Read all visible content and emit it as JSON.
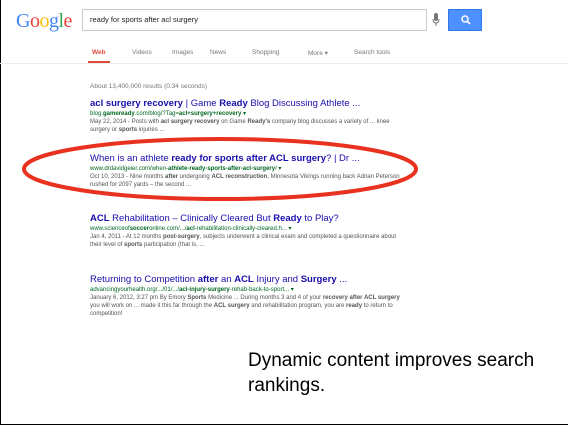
{
  "logo": {
    "letters": [
      "G",
      "o",
      "o",
      "g",
      "l",
      "e"
    ],
    "colors": [
      "#4285f4",
      "#ea4335",
      "#fbbc05",
      "#4285f4",
      "#34a853",
      "#ea4335"
    ]
  },
  "search": {
    "query": "ready for sports after acl surgery"
  },
  "tabs": [
    {
      "label": "Web",
      "active": true
    },
    {
      "label": "Videos",
      "active": false
    },
    {
      "label": "Images",
      "active": false
    },
    {
      "label": "News",
      "active": false
    },
    {
      "label": "Shopping",
      "active": false
    },
    {
      "label": "More ▾",
      "active": false
    },
    {
      "label": "Search tools",
      "active": false
    }
  ],
  "stats": "About 13,400,000 results (0.34 seconds)",
  "results": [
    {
      "title_parts": [
        [
          "acl surgery recovery",
          1
        ],
        [
          " | Game ",
          0
        ],
        [
          "Ready",
          1
        ],
        [
          " Blog Discussing Athlete ...",
          0
        ]
      ],
      "url_parts": [
        [
          "blog.",
          0
        ],
        [
          "gameready",
          1
        ],
        [
          ".com/blog/?Tag=",
          0
        ],
        [
          "acl+surgery+recovery",
          1
        ],
        [
          " ▾",
          0
        ]
      ],
      "snippet_parts": [
        [
          "May 22, 2014 - Posts with ",
          0
        ],
        [
          "acl surgery recovery",
          1
        ],
        [
          " on Game ",
          0
        ],
        [
          "Ready's",
          1
        ],
        [
          " company blog discusses a variety of ... knee surgery or ",
          0
        ],
        [
          "sports",
          1
        ],
        [
          " injuries ...",
          0
        ]
      ]
    },
    {
      "title_parts": [
        [
          "When is an athlete ",
          0
        ],
        [
          "ready for sports after ACL surgery",
          1
        ],
        [
          "? | Dr ...",
          0
        ]
      ],
      "url_parts": [
        [
          "www.drdavidgeier.com/when-",
          0
        ],
        [
          "athlete-ready-sports-after-acl-surgery",
          1
        ],
        [
          "/ ▾",
          0
        ]
      ],
      "snippet_parts": [
        [
          "Oct 10, 2013 - Nine months ",
          0
        ],
        [
          "after",
          1
        ],
        [
          " undergoing ",
          0
        ],
        [
          "ACL reconstruction",
          1
        ],
        [
          ", Minnesota Vikings running back Adrian Peterson rushed for 2097 yards – the second ...",
          0
        ]
      ]
    },
    {
      "title_parts": [
        [
          "ACL",
          1
        ],
        [
          " Rehabilitation – Clinically Cleared But ",
          0
        ],
        [
          "Ready",
          1
        ],
        [
          " to Play?",
          0
        ]
      ],
      "url_parts": [
        [
          "www.science",
          0
        ],
        [
          "of",
          0
        ],
        [
          "soccer",
          1
        ],
        [
          "online.com/.../",
          0
        ],
        [
          "acl",
          1
        ],
        [
          "-rehabilitation-clinically-cleared.h... ▾",
          0
        ]
      ],
      "snippet_parts": [
        [
          "Jan 4, 2011 - At 12 months ",
          0
        ],
        [
          "post-surgery",
          1
        ],
        [
          ", subjects underwent a clinical exam and completed a questionnaire about their level of ",
          0
        ],
        [
          "sports",
          1
        ],
        [
          " participation (that is, ...",
          0
        ]
      ]
    },
    {
      "title_parts": [
        [
          "Returning to Competition ",
          0
        ],
        [
          "after",
          1
        ],
        [
          " an ",
          0
        ],
        [
          "ACL",
          1
        ],
        [
          " Injury and ",
          0
        ],
        [
          "Surgery",
          1
        ],
        [
          " ...",
          0
        ]
      ],
      "url_parts": [
        [
          "advancingyourhealth.org/.../01/.../",
          0
        ],
        [
          "acl-injury-surgery",
          1
        ],
        [
          "-rehab-back-to-sport... ▾",
          0
        ]
      ],
      "snippet_parts": [
        [
          "January 6, 2012, 3:27 pm By Emory ",
          0
        ],
        [
          "Sports",
          1
        ],
        [
          " Medicine ... During months 3 and 4 of your ",
          0
        ],
        [
          "recovery after ACL surgery",
          1
        ],
        [
          " you will work on ... made it this far through the ",
          0
        ],
        [
          "ACL surgery",
          1
        ],
        [
          " and rehabilitation program, you are ",
          0
        ],
        [
          "ready",
          1
        ],
        [
          " to return to competition!",
          0
        ]
      ]
    }
  ],
  "caption": "Dynamic content improves search rankings.",
  "annotation_color": "#e8321f"
}
